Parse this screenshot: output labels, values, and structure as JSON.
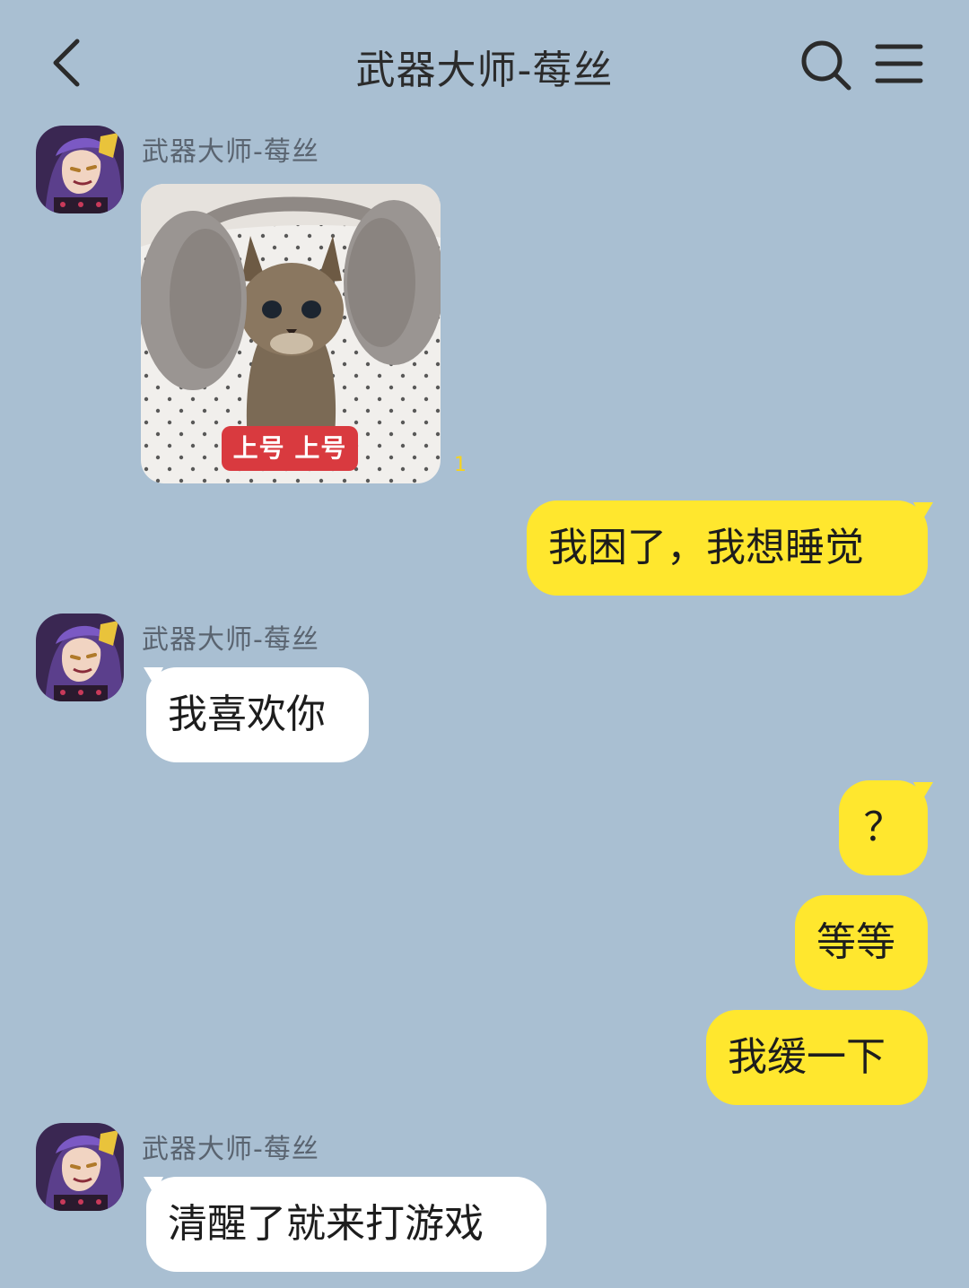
{
  "header": {
    "title": "武器大师-莓丝",
    "back_icon": "back-chevron-icon",
    "search_icon": "search-icon",
    "menu_icon": "menu-icon"
  },
  "messages": [
    {
      "type": "image",
      "direction": "in",
      "sender": "武器大师-莓丝",
      "caption": "上号 上号",
      "read_count": "1"
    },
    {
      "type": "text",
      "direction": "out",
      "text": "我困了，我想睡觉"
    },
    {
      "type": "text",
      "direction": "in",
      "sender": "武器大师-莓丝",
      "text": "我喜欢你"
    },
    {
      "type": "text",
      "direction": "out",
      "text": "？"
    },
    {
      "type": "text",
      "direction": "out",
      "text": "等等"
    },
    {
      "type": "text",
      "direction": "out",
      "text": "我缓一下"
    },
    {
      "type": "text",
      "direction": "in",
      "sender": "武器大师-莓丝",
      "text": "清醒了就来打游戏"
    }
  ],
  "colors": {
    "background": "#a9bfd2",
    "outgoing_bubble": "#ffe72e",
    "incoming_bubble": "#ffffff",
    "caption_red": "#d93a3f"
  }
}
